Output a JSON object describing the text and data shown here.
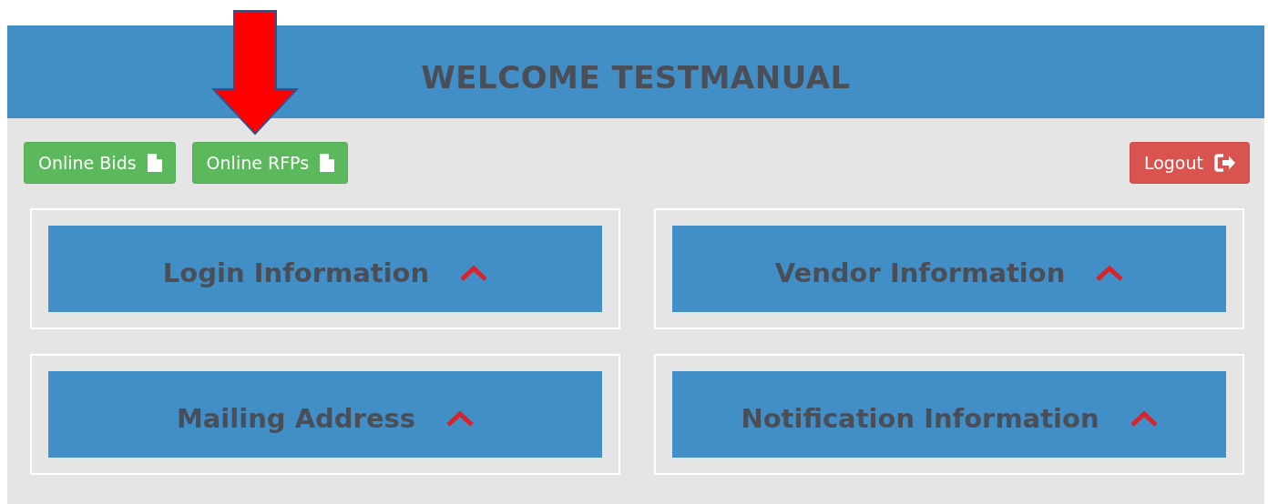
{
  "header": {
    "title": "WELCOME TESTMANUAL"
  },
  "nav_buttons": [
    {
      "label": "Online Bids"
    },
    {
      "label": "Online RFPs"
    }
  ],
  "logout_button": {
    "label": "Logout"
  },
  "sections": [
    {
      "title": "Login Information"
    },
    {
      "title": "Vendor Information"
    },
    {
      "title": "Mailing Address"
    },
    {
      "title": "Notification Information"
    }
  ]
}
